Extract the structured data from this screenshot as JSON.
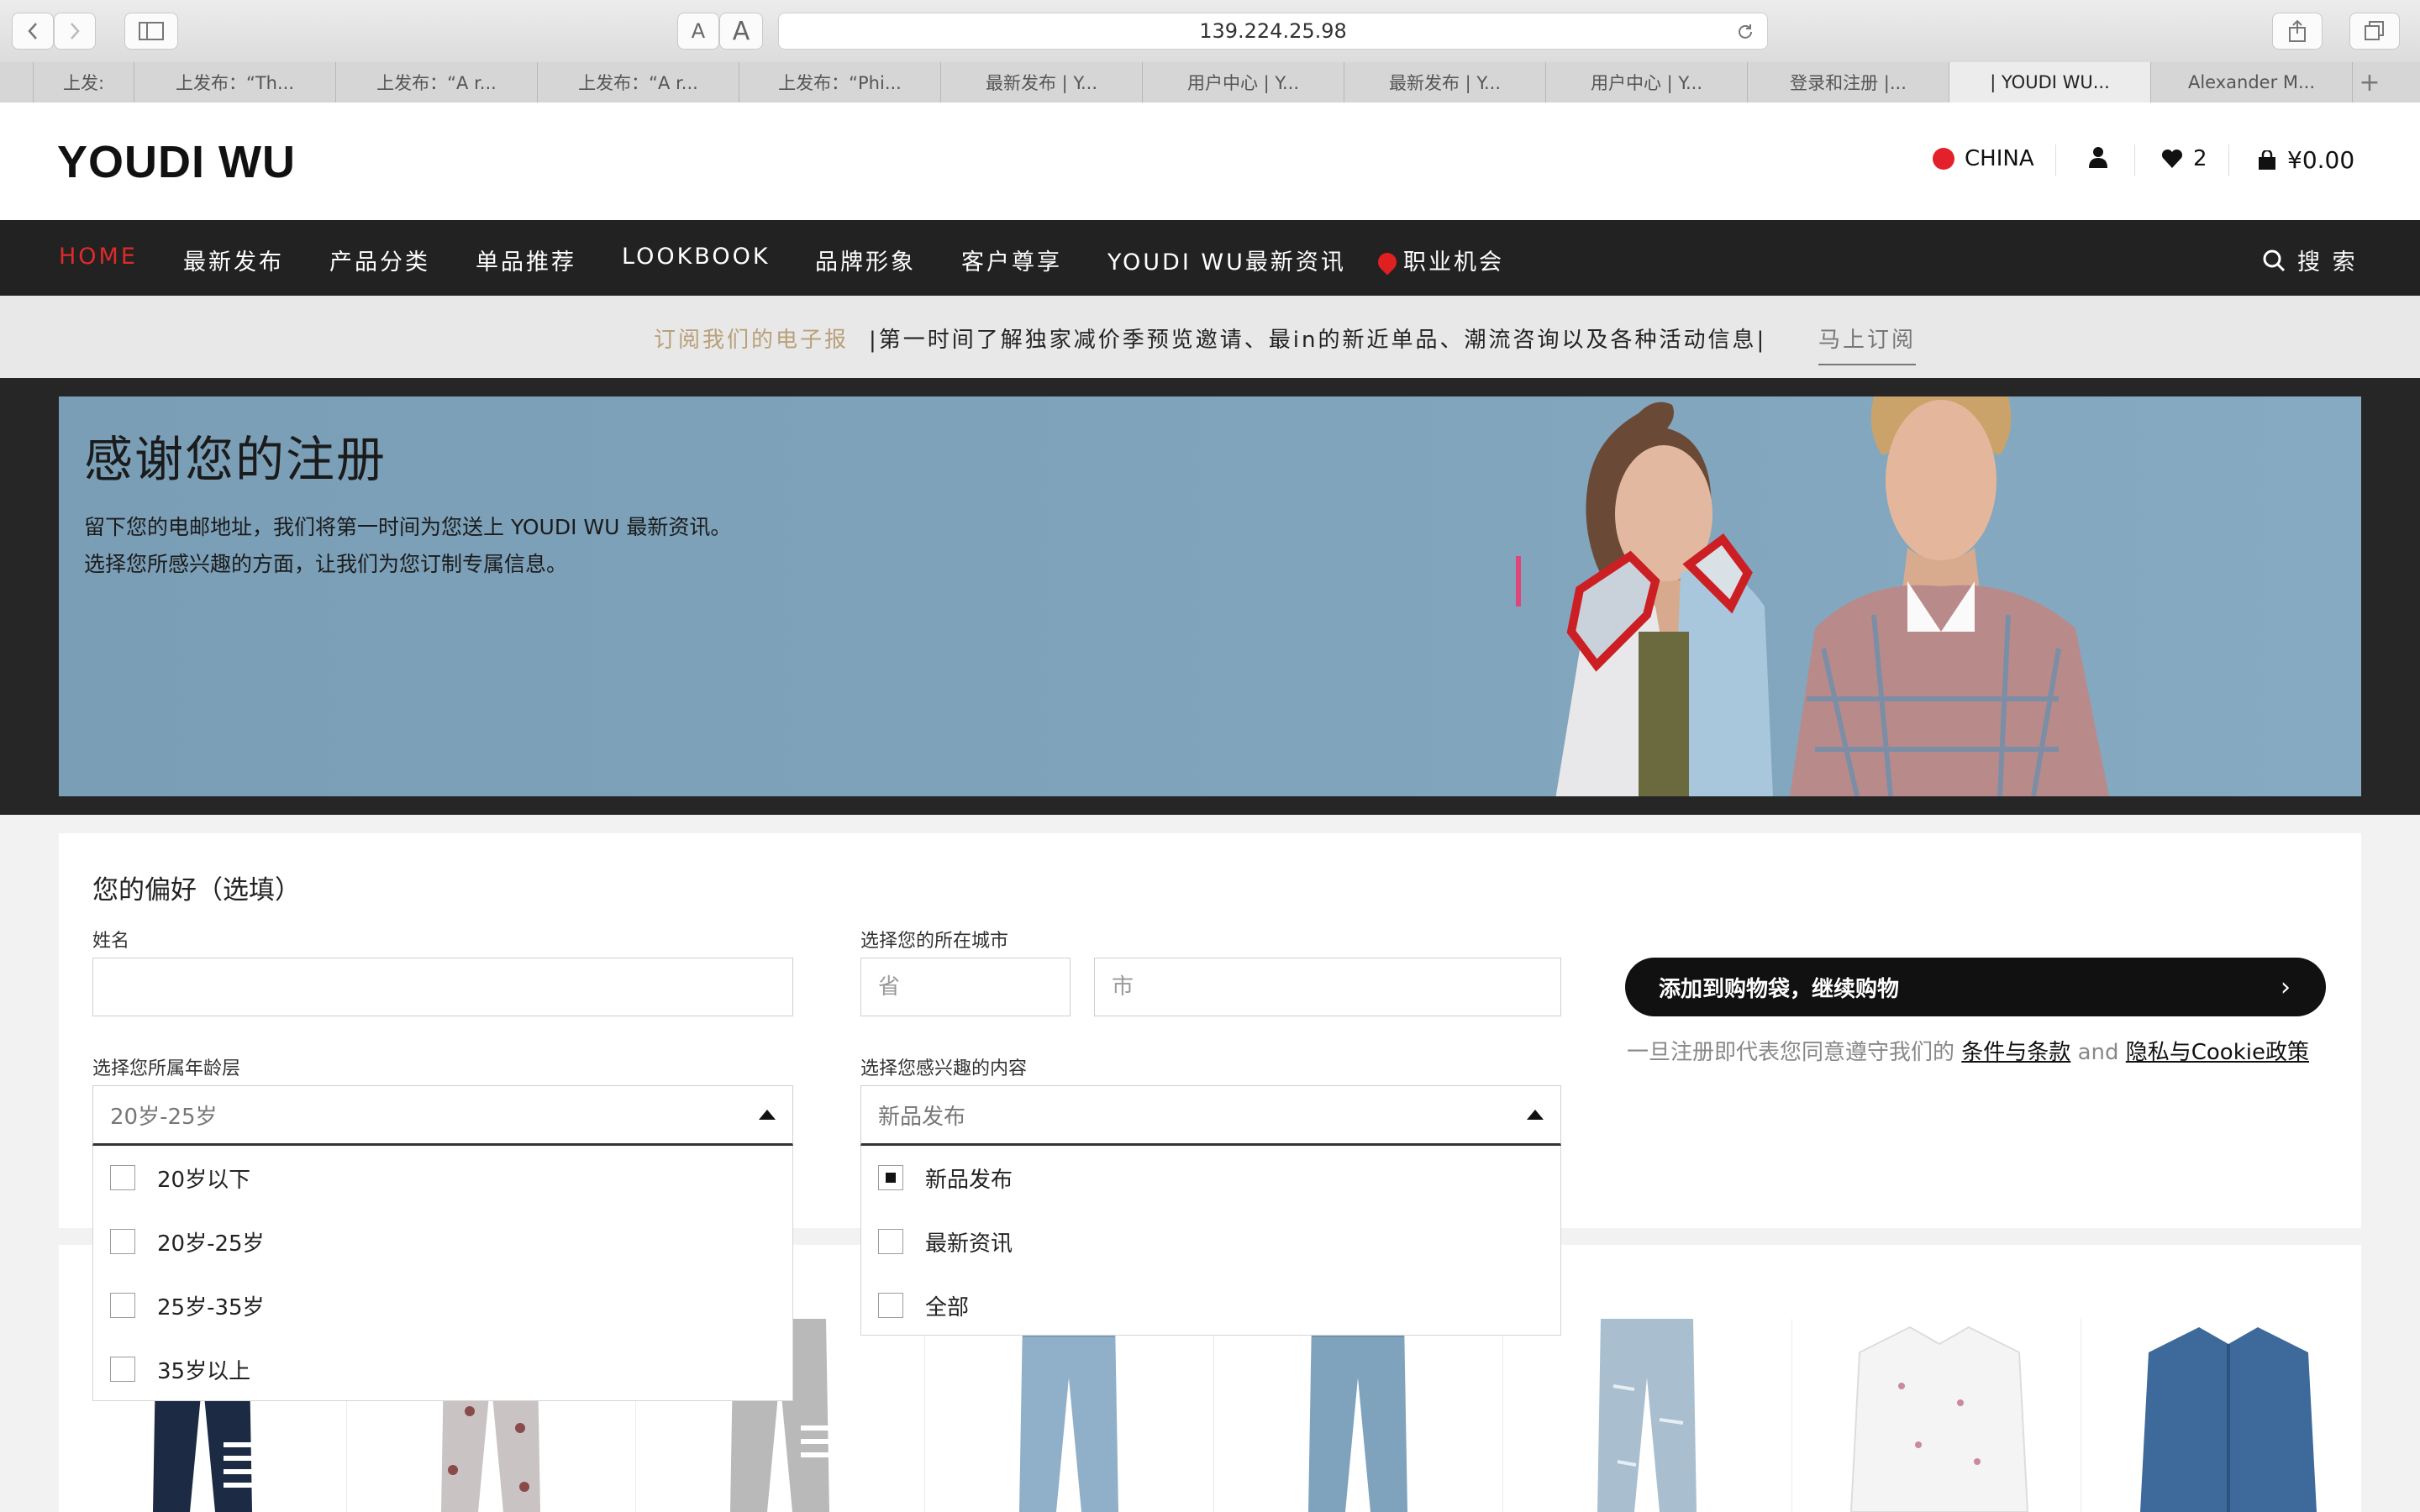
{
  "browser": {
    "url": "139.224.25.98",
    "font_small": "A",
    "font_large": "A",
    "tabs": [
      {
        "title": "上发:"
      },
      {
        "title": "上发布：“Th..."
      },
      {
        "title": "上发布：“A r..."
      },
      {
        "title": "上发布：“A r..."
      },
      {
        "title": "上发布：“Phi..."
      },
      {
        "title": "最新发布 | Y..."
      },
      {
        "title": "用户中心 | Y..."
      },
      {
        "title": "最新发布 | Y..."
      },
      {
        "title": "用户中心 | Y..."
      },
      {
        "title": "登录和注册 |..."
      },
      {
        "title": "| YOUDI WU..."
      },
      {
        "title": "Alexander M..."
      }
    ],
    "new_tab": "+"
  },
  "header": {
    "logo": "YOUDI WU",
    "region": "CHINA",
    "wishlist_count": "2",
    "cart_total": "¥0.00"
  },
  "nav": {
    "items": [
      "HOME",
      "最新发布",
      "产品分类",
      "单品推荐",
      "LOOKBOOK",
      "品牌形象",
      "客户尊享",
      "YOUDI WU最新资讯",
      "职业机会"
    ],
    "search": "搜 索"
  },
  "newsletter": {
    "lead": "订阅我们的电子报",
    "text": "|第一时间了解独家减价季预览邀请、最in的新近单品、潮流咨询以及各种活动信息|",
    "subscribe": "马上订阅"
  },
  "hero": {
    "title": "感谢您的注册",
    "line1": "留下您的电邮地址，我们将第一时间为您送上 YOUDI WU 最新资讯。",
    "line2": "选择您所感兴趣的方面，让我们为您订制专属信息。"
  },
  "form": {
    "title": "您的偏好（选填）",
    "name_label": "姓名",
    "city_label": "选择您的所在城市",
    "province_placeholder": "省",
    "city_placeholder": "市",
    "age_label": "选择您所属年龄层",
    "age_value": "20岁-25岁",
    "age_options": [
      "20岁以下",
      "20岁-25岁",
      "25岁-35岁",
      "35岁以上"
    ],
    "interest_label": "选择您感兴趣的内容",
    "interest_value": "新品发布",
    "interest_options": [
      "新品发布",
      "最新资讯",
      "全部"
    ],
    "interest_checked": [
      true,
      false,
      false
    ],
    "submit": "添加到购物袋，继续购物",
    "terms_prefix": "一旦注册即代表您同意遵守我们的",
    "terms_link": "条件与条款",
    "terms_and": "and",
    "privacy_link": "隐私与Cookie政策"
  }
}
